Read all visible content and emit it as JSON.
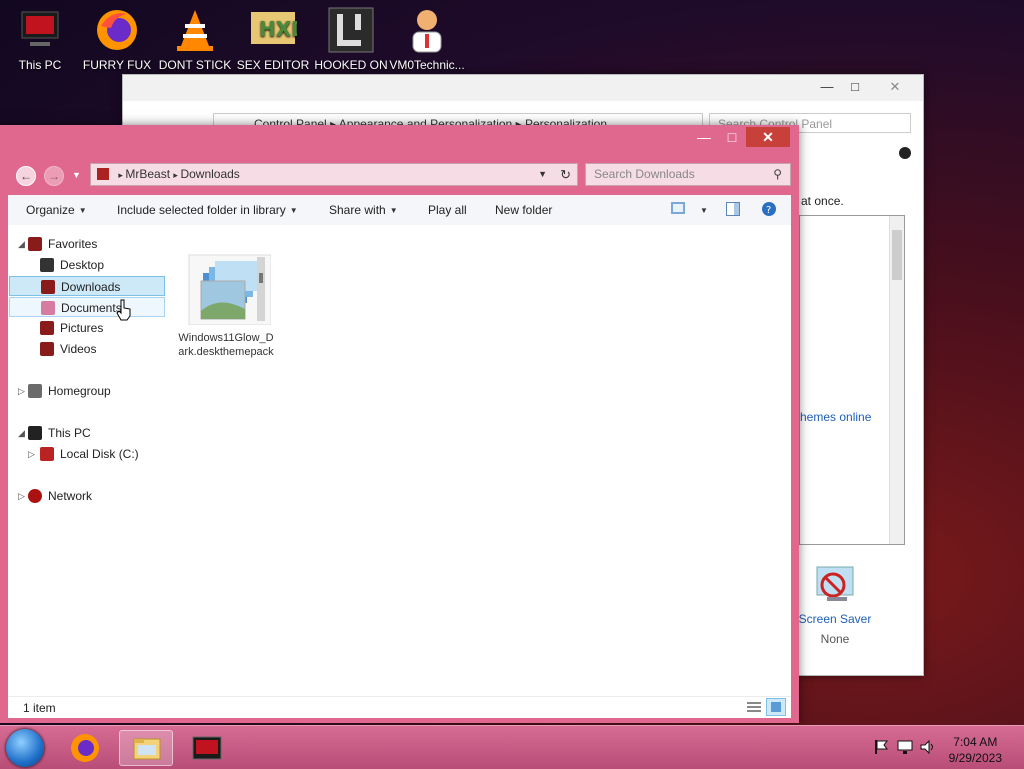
{
  "desktop_icons": [
    {
      "label": "This PC"
    },
    {
      "label": "FURRY FUX"
    },
    {
      "label": "DONT STICK"
    },
    {
      "label": "SEX EDITOR"
    },
    {
      "label": "HOOKED ON"
    },
    {
      "label": "VM0Technic..."
    }
  ],
  "control_panel": {
    "breadcrumb": [
      "Control Panel",
      "Appearance and Personalization",
      "Personalization"
    ],
    "search_placeholder": "Search Control Panel",
    "text_fragment": "at once.",
    "link_themes_online": "hemes online",
    "screen_saver_label": "Screen Saver",
    "screen_saver_value": "None"
  },
  "explorer": {
    "breadcrumb": [
      "MrBeast",
      "Downloads"
    ],
    "search_placeholder": "Search Downloads",
    "toolbar": {
      "organize": "Organize",
      "include": "Include selected folder in library",
      "share": "Share with",
      "play_all": "Play all",
      "new_folder": "New folder"
    },
    "nav": {
      "favorites": "Favorites",
      "desktop": "Desktop",
      "downloads": "Downloads",
      "documents": "Documents",
      "pictures": "Pictures",
      "videos": "Videos",
      "homegroup": "Homegroup",
      "this_pc": "This PC",
      "local_disk": "Local Disk (C:)",
      "network": "Network"
    },
    "files": [
      {
        "name": "Windows11Glow_Dark.deskthemepack"
      }
    ],
    "status": "1 item"
  },
  "taskbar": {
    "clock_time": "7:04 AM",
    "clock_date": "9/29/2023"
  },
  "colors": {
    "window_frame": "#e0688f",
    "close_button": "#c8403a",
    "selection": "#cde8f7",
    "link": "#1e5fb4"
  }
}
